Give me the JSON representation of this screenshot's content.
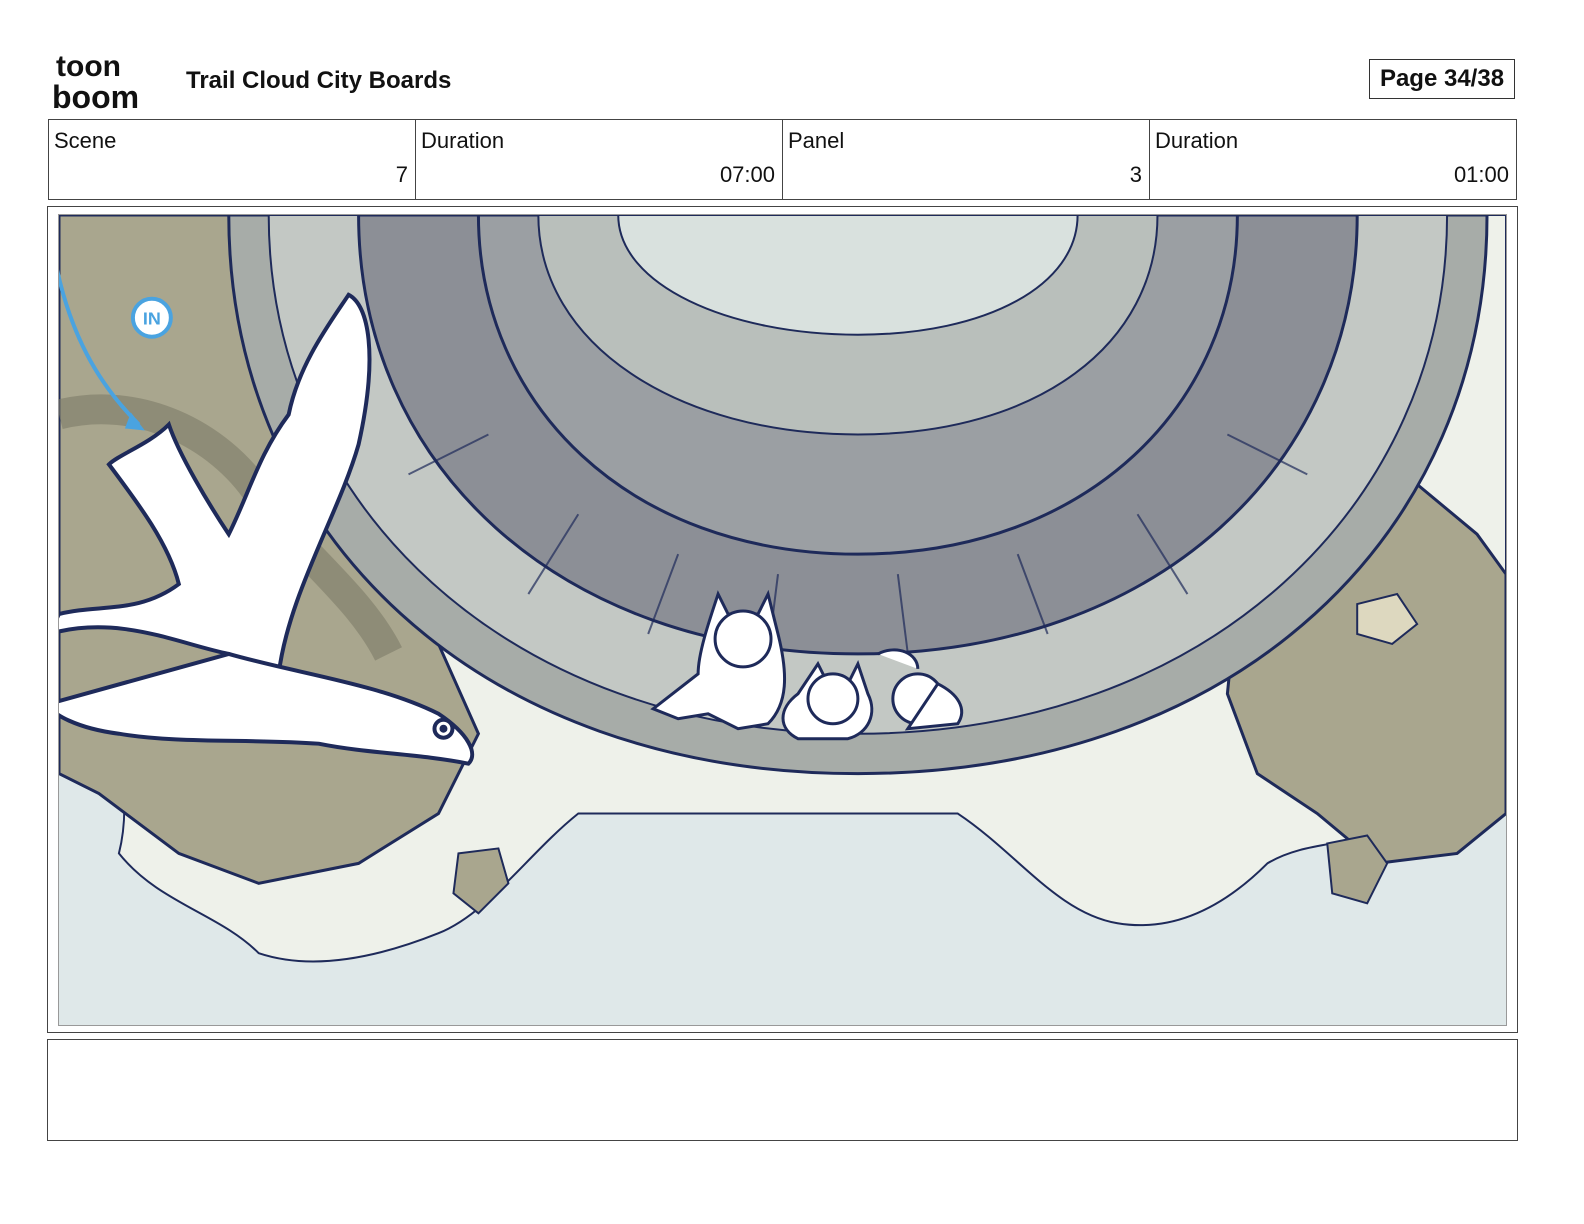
{
  "logo": {
    "line1": "toon",
    "line2": "boom"
  },
  "header": {
    "title": "Trail Cloud City Boards",
    "page": "Page 34/38"
  },
  "info": [
    {
      "label": "Scene",
      "value": "7"
    },
    {
      "label": "Duration",
      "value": "07:00"
    },
    {
      "label": "Panel",
      "value": "3"
    },
    {
      "label": "Duration",
      "value": "01:00"
    }
  ],
  "panel": {
    "in_marker": "IN"
  },
  "colors": {
    "sky": "#dfe8e9",
    "cloud": "#eef1ea",
    "stone": "#9a9f9a",
    "rock": "#a9a68e",
    "line": "#1e2a5a",
    "accent": "#4aa3e0"
  }
}
